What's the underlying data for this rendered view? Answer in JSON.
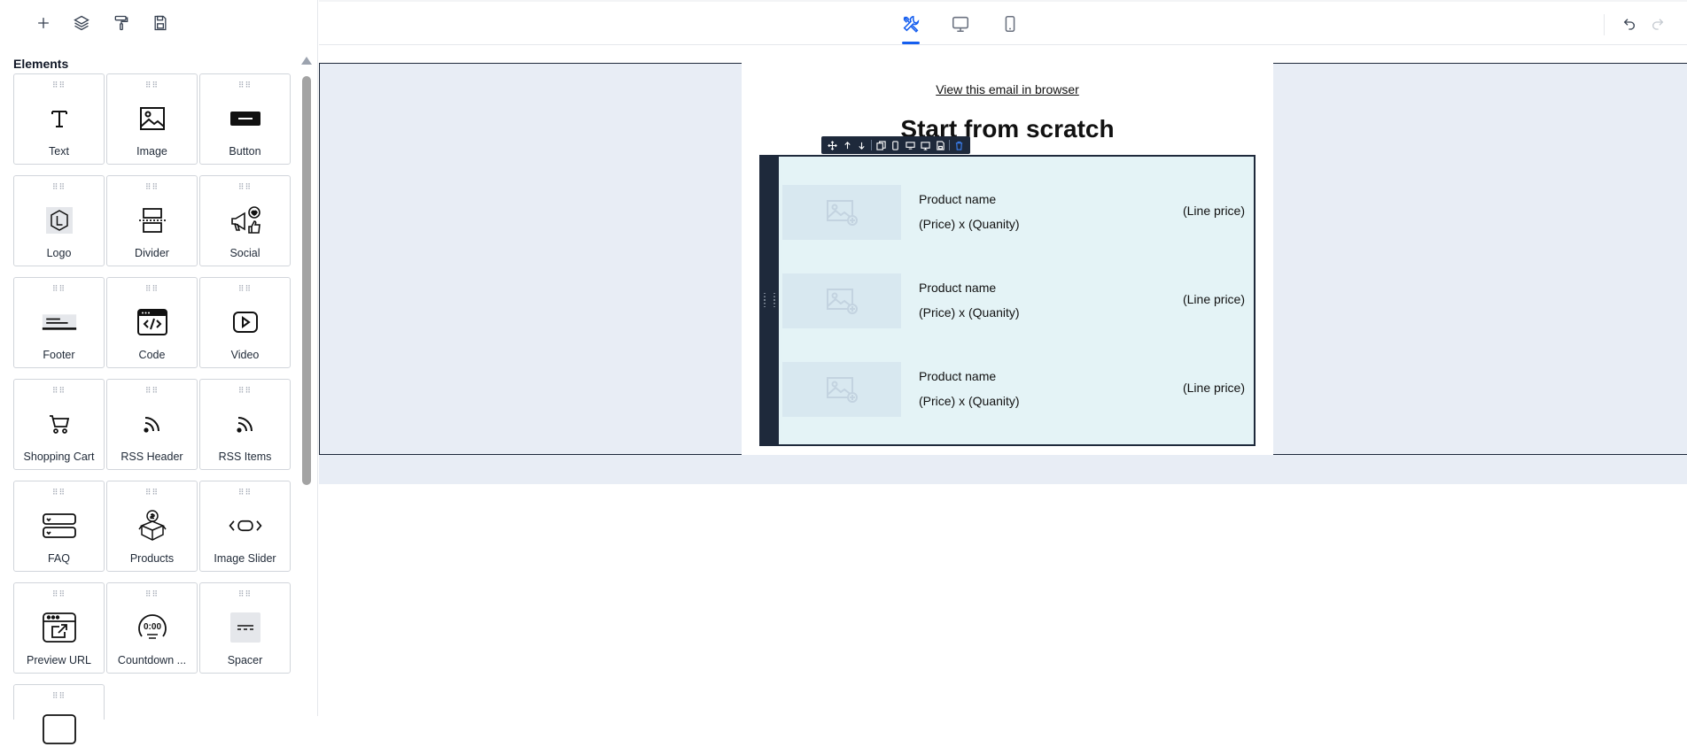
{
  "sidebar": {
    "tools": [
      {
        "icon": "plus-icon",
        "label": "Add"
      },
      {
        "icon": "layers-icon",
        "label": "Layers"
      },
      {
        "icon": "paint-roller-icon",
        "label": "Styles"
      },
      {
        "icon": "save-icon",
        "label": "Save"
      }
    ],
    "title": "Elements",
    "grip": "⠿⠿",
    "elements": [
      {
        "label": "Text",
        "icon": "text-icon"
      },
      {
        "label": "Image",
        "icon": "image-icon"
      },
      {
        "label": "Button",
        "icon": "button-icon"
      },
      {
        "label": "Logo",
        "icon": "logo-icon"
      },
      {
        "label": "Divider",
        "icon": "divider-icon"
      },
      {
        "label": "Social",
        "icon": "social-icon"
      },
      {
        "label": "Footer",
        "icon": "footer-icon"
      },
      {
        "label": "Code",
        "icon": "code-icon"
      },
      {
        "label": "Video",
        "icon": "video-icon"
      },
      {
        "label": "Shopping Cart",
        "icon": "shopping-cart-icon"
      },
      {
        "label": "RSS Header",
        "icon": "rss-icon"
      },
      {
        "label": "RSS Items",
        "icon": "rss-icon"
      },
      {
        "label": "FAQ",
        "icon": "faq-icon"
      },
      {
        "label": "Products",
        "icon": "products-icon"
      },
      {
        "label": "Image Slider",
        "icon": "image-slider-icon"
      },
      {
        "label": "Preview URL",
        "icon": "preview-url-icon"
      },
      {
        "label": "Countdown ...",
        "icon": "countdown-icon"
      },
      {
        "label": "Spacer",
        "icon": "spacer-icon"
      },
      {
        "label": "",
        "icon": "partial-element-icon"
      }
    ]
  },
  "topbar": {
    "views": [
      {
        "icon": "design-tools-icon",
        "active": true
      },
      {
        "icon": "desktop-icon",
        "active": false
      },
      {
        "icon": "mobile-icon",
        "active": false
      }
    ],
    "undo": {
      "icon": "undo-icon"
    },
    "redo": {
      "icon": "redo-icon",
      "disabled": true
    }
  },
  "email": {
    "view_link": "View this email in browser",
    "heading": "Start from scratch",
    "cart_items": [
      {
        "name": "Product name",
        "price_qty": "(Price) x (Quanity)",
        "line_price": "(Line price)"
      },
      {
        "name": "Product name",
        "price_qty": "(Price) x (Quanity)",
        "line_price": "(Line price)"
      },
      {
        "name": "Product name",
        "price_qty": "(Price) x (Quanity)",
        "line_price": "(Line price)"
      }
    ]
  },
  "colors": {
    "accent": "#155eef",
    "canvas_bg": "#e8edf5",
    "block_bg": "#e4f3f6",
    "block_border": "#1e293b"
  }
}
